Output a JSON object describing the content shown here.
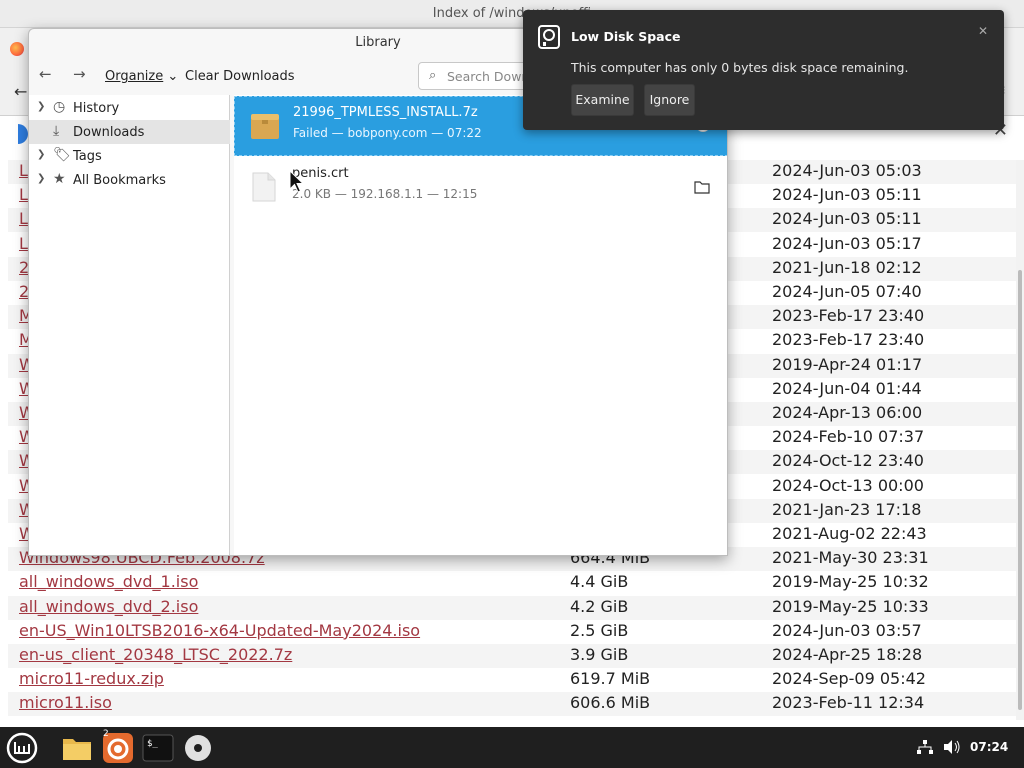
{
  "browser": {
    "window_title": "Index of /windows/unoffi",
    "files": [
      {
        "name": "L",
        "size": "",
        "date": "2024-Jun-03 05:03"
      },
      {
        "name": "L",
        "size": "",
        "date": "2024-Jun-03 05:11"
      },
      {
        "name": "L",
        "size": "",
        "date": "2024-Jun-03 05:11"
      },
      {
        "name": "L",
        "size": "",
        "date": "2024-Jun-03 05:17"
      },
      {
        "name": "2",
        "size": "",
        "date": "2021-Jun-18 02:12"
      },
      {
        "name": "2",
        "size": "",
        "date": "2024-Jun-05 07:40"
      },
      {
        "name": "M",
        "size": "",
        "date": "2023-Feb-17 23:40"
      },
      {
        "name": "M",
        "size": "",
        "date": "2023-Feb-17 23:40"
      },
      {
        "name": "W",
        "size": "",
        "date": "2019-Apr-24 01:17"
      },
      {
        "name": "W",
        "size": "",
        "date": "2024-Jun-04 01:44"
      },
      {
        "name": "W",
        "size": "",
        "date": "2024-Apr-13 06:00"
      },
      {
        "name": "W",
        "size": "",
        "date": "2024-Feb-10 07:37"
      },
      {
        "name": "W",
        "size": "",
        "date": "2024-Oct-12 23:40"
      },
      {
        "name": "W",
        "size": "",
        "date": "2024-Oct-13 00:00"
      },
      {
        "name": "W",
        "size": "",
        "date": "2021-Jan-23 17:18"
      },
      {
        "name": "W",
        "size": "",
        "date": "2021-Aug-02 22:43"
      },
      {
        "name": "Windows98.UBCD.Feb.2008.7z",
        "size": "664.4 MiB",
        "date": "2021-May-30 23:31"
      },
      {
        "name": "all_windows_dvd_1.iso",
        "size": "4.4 GiB",
        "date": "2019-May-25 10:32"
      },
      {
        "name": "all_windows_dvd_2.iso",
        "size": "4.2 GiB",
        "date": "2019-May-25 10:33"
      },
      {
        "name": "en-US_Win10LTSB2016-x64-Updated-May2024.iso",
        "size": "2.5 GiB",
        "date": "2024-Jun-03 03:57"
      },
      {
        "name": "en-us_client_20348_LTSC_2022.7z",
        "size": "3.9 GiB",
        "date": "2024-Apr-25 18:28"
      },
      {
        "name": "micro11-redux.zip",
        "size": "619.7 MiB",
        "date": "2024-Sep-09 05:42"
      },
      {
        "name": "micro11.iso",
        "size": "606.6 MiB",
        "date": "2023-Feb-11 12:34"
      }
    ]
  },
  "library": {
    "title": "Library",
    "organize_label": "Organize",
    "clear_label": "Clear Downloads",
    "search_placeholder": "Search Down",
    "sidebar": [
      {
        "label": "History",
        "icon": "clock-icon"
      },
      {
        "label": "Downloads",
        "icon": "download-icon"
      },
      {
        "label": "Tags",
        "icon": "tag-icon"
      },
      {
        "label": "All Bookmarks",
        "icon": "star-icon"
      }
    ],
    "downloads": [
      {
        "name": "21996_TPMLESS_INSTALL.7z",
        "meta": "Failed — bobpony.com — 07:22"
      },
      {
        "name": "penis.crt",
        "meta": "2.0 KB — 192.168.1.1 — 12:15"
      }
    ]
  },
  "notification": {
    "title": "Low Disk Space",
    "body": "This computer has only 0 bytes disk space remaining.",
    "examine_label": "Examine",
    "ignore_label": "Ignore"
  },
  "taskbar": {
    "clock": "07:24",
    "badge": "2"
  }
}
